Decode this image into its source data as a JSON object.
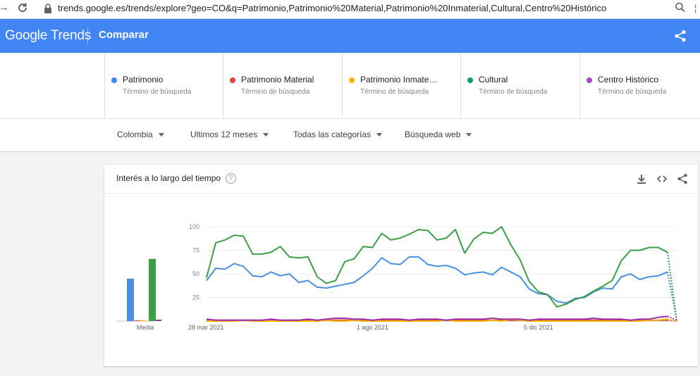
{
  "browser": {
    "url": "trends.google.es/trends/explore?geo=CO&q=Patrimonio,Patrimonio%20Material,Patrimonio%20Inmaterial,Cultural,Centro%20Histórico",
    "extra": "¦"
  },
  "header": {
    "logo_google": "Google",
    "logo_trends": "Trends",
    "title": "Comparar"
  },
  "terms": [
    {
      "name": "Patrimonio",
      "sub": "Término de búsqueda",
      "color": "#4285f4"
    },
    {
      "name": "Patrimonio Material",
      "sub": "Término de búsqueda",
      "color": "#db4437"
    },
    {
      "name": "Patrimonio Inmate…",
      "sub": "Término de búsqueda",
      "color": "#f4b400"
    },
    {
      "name": "Cultural",
      "sub": "Término de búsqueda",
      "color": "#0f9d58"
    },
    {
      "name": "Centro Histórico",
      "sub": "Término de búsqueda",
      "color": "#ab47bc"
    }
  ],
  "filters": {
    "region": "Colombia",
    "period": "Ultimos 12 meses",
    "category": "Todas las categorías",
    "type": "Búsqueda web"
  },
  "card": {
    "title": "Interés a lo largo del tiempo",
    "help": "?"
  },
  "chart_data": {
    "type": "line",
    "ylim": [
      0,
      100
    ],
    "yticks": [
      25,
      50,
      75,
      100
    ],
    "xtick_labels": [
      "28 mar 2021",
      "1 ago 2021",
      "5 dic 2021"
    ],
    "average_label": "Media",
    "averages": [
      {
        "name": "Patrimonio",
        "value": 45,
        "color": "#4a90e2"
      },
      {
        "name": "Patrimonio Material",
        "value": 0,
        "color": "#db4437"
      },
      {
        "name": "Patrimonio Inmaterial",
        "value": 0,
        "color": "#f4b400"
      },
      {
        "name": "Cultural",
        "value": 66,
        "color": "#3c9e47"
      },
      {
        "name": "Centro Histórico",
        "value": 1,
        "color": "#9b2fae"
      }
    ],
    "series": [
      {
        "name": "Patrimonio",
        "color": "#4a90e2",
        "values": [
          43,
          56,
          55,
          61,
          58,
          48,
          47,
          52,
          48,
          50,
          41,
          43,
          36,
          35,
          37,
          39,
          41,
          48,
          56,
          67,
          61,
          60,
          68,
          68,
          60,
          58,
          59,
          56,
          49,
          51,
          52,
          49,
          57,
          52,
          47,
          34,
          29,
          28,
          21,
          19,
          24,
          25,
          31,
          35,
          34,
          47,
          50,
          44,
          47,
          48,
          52,
          1
        ]
      },
      {
        "name": "Patrimonio Material",
        "color": "#db4437",
        "values": [
          1,
          1,
          1,
          1,
          1,
          1,
          1,
          1,
          1,
          1,
          1,
          1,
          1,
          1,
          1,
          1,
          1,
          1,
          1,
          1,
          1,
          1,
          1,
          1,
          1,
          1,
          1,
          1,
          1,
          1,
          1,
          1,
          1,
          1,
          1,
          1,
          1,
          1,
          1,
          1,
          1,
          1,
          1,
          1,
          1,
          1,
          1,
          1,
          1,
          1,
          1,
          0
        ]
      },
      {
        "name": "Patrimonio Inmaterial",
        "color": "#f4b400",
        "values": [
          0,
          0,
          0,
          0,
          1,
          0,
          0,
          0,
          0,
          0,
          0,
          0,
          0,
          1,
          0,
          0,
          1,
          0,
          0,
          0,
          0,
          0,
          0,
          0,
          0,
          0,
          1,
          0,
          0,
          0,
          0,
          1,
          0,
          2,
          1,
          0,
          0,
          0,
          0,
          0,
          0,
          0,
          0,
          0,
          0,
          0,
          0,
          0,
          1,
          1,
          2,
          0
        ]
      },
      {
        "name": "Cultural",
        "color": "#3c9e47",
        "values": [
          46,
          83,
          86,
          91,
          90,
          71,
          71,
          73,
          79,
          68,
          67,
          68,
          47,
          40,
          43,
          63,
          66,
          79,
          78,
          93,
          86,
          88,
          92,
          97,
          96,
          86,
          88,
          97,
          72,
          87,
          94,
          93,
          100,
          81,
          65,
          42,
          31,
          28,
          15,
          18,
          23,
          26,
          32,
          37,
          43,
          64,
          75,
          75,
          78,
          78,
          73,
          1
        ]
      },
      {
        "name": "Centro Histórico",
        "color": "#9b2fae",
        "values": [
          2,
          1,
          1,
          1,
          1,
          1,
          1,
          2,
          1,
          1,
          1,
          2,
          1,
          2,
          3,
          3,
          2,
          2,
          1,
          2,
          2,
          2,
          1,
          2,
          2,
          2,
          1,
          2,
          2,
          2,
          2,
          3,
          2,
          2,
          2,
          1,
          2,
          2,
          2,
          2,
          2,
          2,
          3,
          2,
          2,
          2,
          1,
          2,
          2,
          4,
          5,
          1
        ]
      }
    ]
  }
}
